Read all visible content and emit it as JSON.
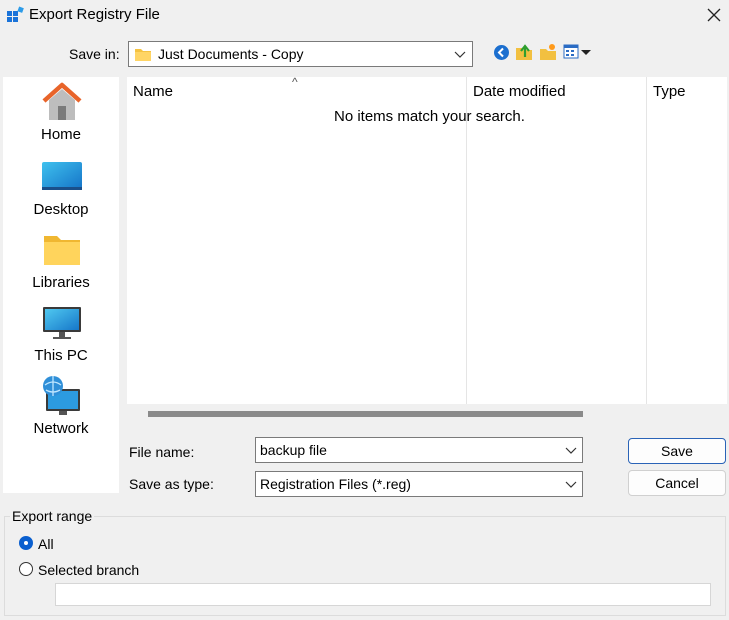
{
  "window": {
    "title": "Export Registry File",
    "close_icon": "close-icon",
    "app_icon": "registry-editor-icon"
  },
  "save_in": {
    "label": "Save in:",
    "value": "Just Documents - Copy",
    "folder_icon": "folder-icon",
    "toolbar": [
      "back-icon",
      "up-folder-icon",
      "new-folder-icon",
      "view-menu-icon"
    ]
  },
  "places": [
    {
      "label": "Home",
      "icon": "home-icon"
    },
    {
      "label": "Desktop",
      "icon": "desktop-icon"
    },
    {
      "label": "Libraries",
      "icon": "libraries-icon"
    },
    {
      "label": "This PC",
      "icon": "this-pc-icon"
    },
    {
      "label": "Network",
      "icon": "network-icon"
    }
  ],
  "file_list": {
    "columns": [
      "Name",
      "Date modified",
      "Type"
    ],
    "empty_message": "No items match your search."
  },
  "file_name": {
    "label": "File name:",
    "value": "backup file"
  },
  "save_as_type": {
    "label": "Save as type:",
    "value": "Registration Files (*.reg)"
  },
  "buttons": {
    "save": "Save",
    "cancel": "Cancel"
  },
  "export_range": {
    "legend": "Export range",
    "options": [
      "All",
      "Selected branch"
    ],
    "selected": "All",
    "branch_value": ""
  },
  "colors": {
    "accent": "#0a5fcf",
    "background": "#f0f0f0",
    "folder": "#f5c342"
  }
}
